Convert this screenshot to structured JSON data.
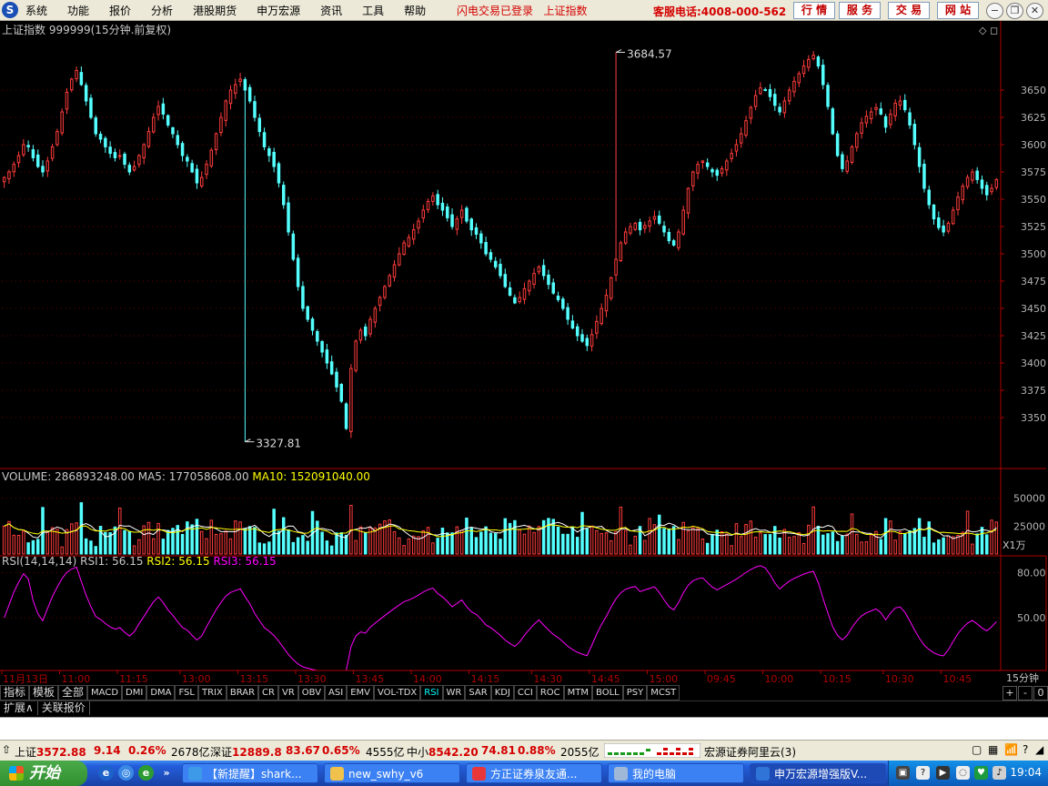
{
  "menubar": {
    "logo": "S",
    "menus": [
      "系统",
      "功能",
      "报价",
      "分析",
      "港股期货",
      "申万宏源",
      "资讯",
      "工具",
      "帮助"
    ],
    "notice": "闪电交易已登录",
    "index_link": "上证指数",
    "hotline": "客服电话:4008-000-562",
    "buttons": [
      "行 情",
      "服 务",
      "交 易",
      "网 站"
    ]
  },
  "chart_data": [
    {
      "type": "candlestick",
      "title": "上证指数 999999(15分钟.前复权)",
      "ylim": [
        3310,
        3695
      ],
      "yticks": [
        3350,
        3375,
        3400,
        3425,
        3450,
        3475,
        3500,
        3525,
        3550,
        3575,
        3600,
        3625,
        3650
      ],
      "annotations": [
        {
          "label": "3684.57",
          "value": 3684.57,
          "bar": 127
        },
        {
          "label": "3327.81",
          "value": 3327.81,
          "bar": 50
        }
      ],
      "close": [
        3570,
        3575,
        3582,
        3590,
        3600,
        3598,
        3588,
        3580,
        3575,
        3585,
        3598,
        3612,
        3630,
        3648,
        3660,
        3668,
        3655,
        3640,
        3625,
        3610,
        3605,
        3598,
        3592,
        3588,
        3590,
        3582,
        3575,
        3580,
        3590,
        3600,
        3612,
        3625,
        3635,
        3628,
        3618,
        3610,
        3600,
        3590,
        3585,
        3575,
        3565,
        3570,
        3582,
        3595,
        3610,
        3625,
        3640,
        3650,
        3655,
        3660,
        3650,
        3640,
        3625,
        3612,
        3598,
        3590,
        3580,
        3565,
        3545,
        3520,
        3495,
        3470,
        3450,
        3440,
        3430,
        3420,
        3410,
        3400,
        3390,
        3378,
        3365,
        3340,
        3395,
        3420,
        3430,
        3425,
        3440,
        3450,
        3460,
        3470,
        3480,
        3490,
        3500,
        3510,
        3515,
        3522,
        3530,
        3540,
        3548,
        3553,
        3545,
        3540,
        3533,
        3525,
        3532,
        3540,
        3530,
        3522,
        3518,
        3510,
        3500,
        3495,
        3488,
        3480,
        3470,
        3462,
        3455,
        3460,
        3468,
        3475,
        3482,
        3488,
        3480,
        3472,
        3464,
        3458,
        3450,
        3440,
        3432,
        3425,
        3420,
        3416,
        3426,
        3438,
        3450,
        3462,
        3478,
        3495,
        3510,
        3520,
        3525,
        3528,
        3522,
        3526,
        3530,
        3534,
        3528,
        3520,
        3512,
        3508,
        3520,
        3540,
        3560,
        3575,
        3582,
        3585,
        3580,
        3575,
        3572,
        3578,
        3585,
        3592,
        3600,
        3610,
        3622,
        3634,
        3645,
        3652,
        3650,
        3644,
        3636,
        3630,
        3640,
        3650,
        3658,
        3665,
        3672,
        3678,
        3682,
        3672,
        3655,
        3635,
        3610,
        3590,
        3578,
        3585,
        3598,
        3610,
        3620,
        3626,
        3630,
        3634,
        3628,
        3616,
        3628,
        3638,
        3640,
        3632,
        3618,
        3600,
        3580,
        3560,
        3545,
        3532,
        3524,
        3520,
        3528,
        3540,
        3552,
        3562,
        3570,
        3575,
        3568,
        3560,
        3554,
        3560,
        3568
      ]
    },
    {
      "type": "bar",
      "title": "VOLUME",
      "volume": "286893248.00",
      "ma5": "177058608.00",
      "ma10": "152091040.00",
      "ylim": [
        0,
        62000
      ],
      "yticks": [
        25000,
        50000
      ],
      "unit": "X1万"
    },
    {
      "type": "line",
      "title": "RSI(14,14,14)",
      "rsi1": "56.15",
      "rsi2": "56.15",
      "rsi3": "56.15",
      "ylim": [
        15,
        90
      ],
      "yticks": [
        50,
        80
      ],
      "ytick_labels": [
        "50.00",
        "80.00"
      ]
    }
  ],
  "chart_colors": {
    "up": "#ff3c3c",
    "down": "#54ffff",
    "ma5": "#ffffff",
    "ma10": "#ffff00",
    "rsi": "#ff00ff",
    "axis": "#b00000",
    "title": "#c8c8c8",
    "tick": "#b4b4b4",
    "annotation": "#dcdcdc"
  },
  "time_axis": {
    "labels": [
      "11月13日",
      "11:00",
      "11:15",
      "13:00",
      "13:15",
      "13:30",
      "13:45",
      "14:00",
      "14:15",
      "14:30",
      "14:45",
      "15:00",
      "09:45",
      "10:00",
      "10:15",
      "10:30",
      "10:45"
    ],
    "period": "15分钟"
  },
  "indicator_tabs": {
    "cn": [
      "指标",
      "模板",
      "全部"
    ],
    "items": [
      "MACD",
      "DMI",
      "DMA",
      "FSL",
      "TRIX",
      "BRAR",
      "CR",
      "VR",
      "OBV",
      "ASI",
      "EMV",
      "VOL-TDX",
      "RSI",
      "WR",
      "SAR",
      "KDJ",
      "CCI",
      "ROC",
      "MTM",
      "BOLL",
      "PSY",
      "MCST"
    ],
    "selected": "RSI",
    "nav": [
      "+",
      "-",
      "0"
    ]
  },
  "ext_tabs": [
    "扩展∧",
    "关联报价"
  ],
  "status": {
    "sh_label": "上证",
    "sh_price": "3572.88",
    "sh_change": "9.14",
    "sh_pct": "0.26%",
    "sh_amount": "2678亿",
    "sz_label": "深证",
    "sz_price": "12889.8",
    "sz_change": "83.67",
    "sz_pct": "0.65%",
    "sz_amount": "4555亿",
    "zx_label": "中小",
    "zx_price": "8542.20",
    "zx_change": "74.81",
    "zx_pct": "0.88%",
    "zx_amount": "2055亿",
    "server": "宏源证券阿里云(3)"
  },
  "taskbar": {
    "start": "开始",
    "tasks": [
      "【新提醒】shark...",
      "new_swhy_v6",
      "方正证券泉友通...",
      "我的电脑",
      "申万宏源增强版V..."
    ],
    "clock": "19:04"
  }
}
